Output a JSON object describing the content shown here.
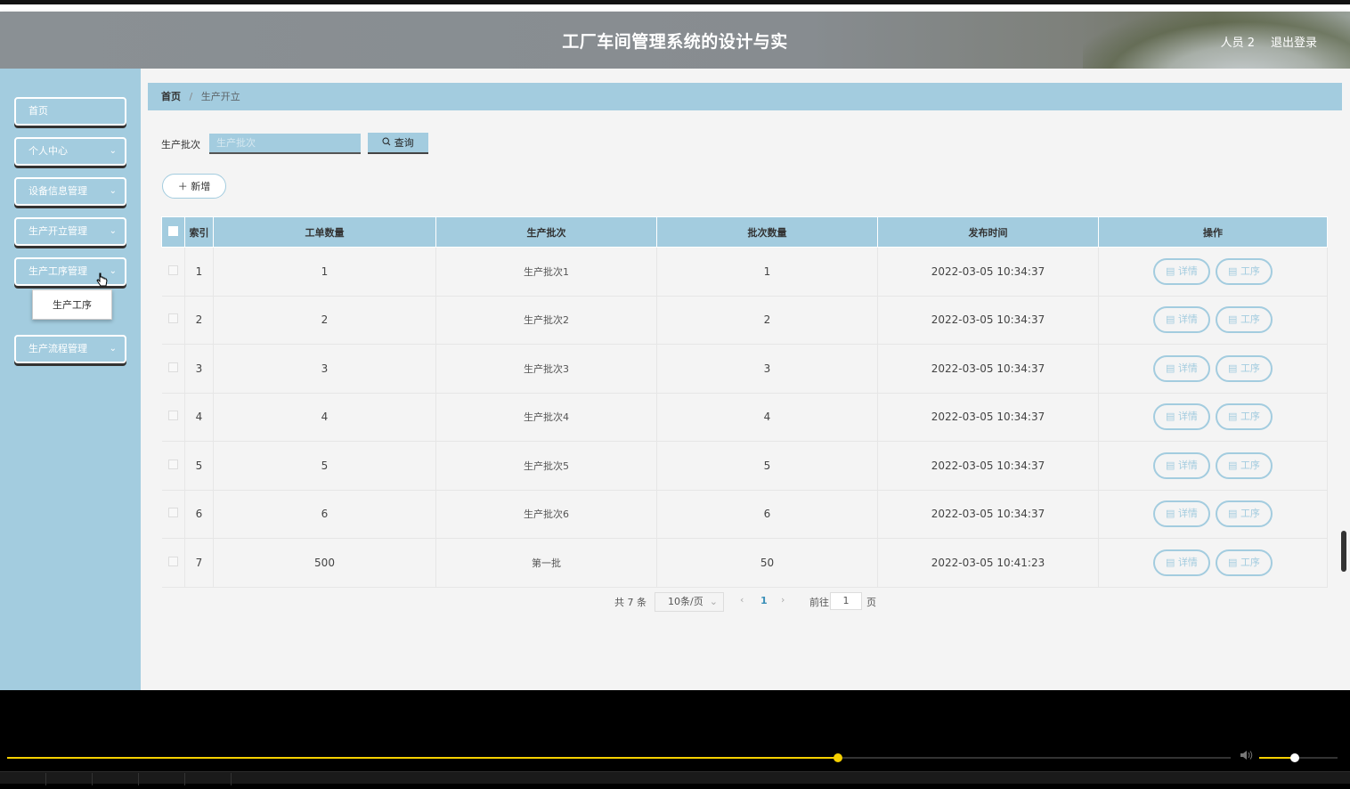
{
  "header": {
    "title": "工厂车间管理系统的设计与实",
    "user": "人员 2",
    "logout": "退出登录"
  },
  "sidebar": {
    "items": [
      {
        "label": "首页",
        "has_chevron": false
      },
      {
        "label": "个人中心",
        "has_chevron": true
      },
      {
        "label": "设备信息管理",
        "has_chevron": true
      },
      {
        "label": "生产开立管理",
        "has_chevron": true
      },
      {
        "label": "生产工序管理",
        "has_chevron": true
      },
      {
        "label": "生产流程管理",
        "has_chevron": true
      }
    ],
    "submenu_item": "生产工序",
    "chevron": "⌄"
  },
  "breadcrumb": {
    "home": "首页",
    "separator": "/",
    "current": "生产开立"
  },
  "search": {
    "label": "生产批次",
    "placeholder": "生产批次",
    "button": "查询",
    "button_icon": "search-icon"
  },
  "add_button": "新增",
  "table": {
    "columns": [
      "索引",
      "工单数量",
      "生产批次",
      "批次数量",
      "发布时间",
      "操作"
    ],
    "rows": [
      {
        "index": "1",
        "orders": "1",
        "batch": "生产批次1",
        "batch_qty": "1",
        "time": "2022-03-05 10:34:37"
      },
      {
        "index": "2",
        "orders": "2",
        "batch": "生产批次2",
        "batch_qty": "2",
        "time": "2022-03-05 10:34:37"
      },
      {
        "index": "3",
        "orders": "3",
        "batch": "生产批次3",
        "batch_qty": "3",
        "time": "2022-03-05 10:34:37"
      },
      {
        "index": "4",
        "orders": "4",
        "batch": "生产批次4",
        "batch_qty": "4",
        "time": "2022-03-05 10:34:37"
      },
      {
        "index": "5",
        "orders": "5",
        "batch": "生产批次5",
        "batch_qty": "5",
        "time": "2022-03-05 10:34:37"
      },
      {
        "index": "6",
        "orders": "6",
        "batch": "生产批次6",
        "batch_qty": "6",
        "time": "2022-03-05 10:34:37"
      },
      {
        "index": "7",
        "orders": "500",
        "batch": "第一批",
        "batch_qty": "50",
        "time": "2022-03-05 10:41:23"
      }
    ],
    "actions": [
      "详情",
      "工序"
    ]
  },
  "pagination": {
    "total": "共 7 条",
    "page_size": "10条/页",
    "current_page": "1",
    "goto_label": "前往",
    "goto_value": "1",
    "page_suffix": "页"
  },
  "player": {
    "progress": 0.679,
    "volume": 0.45
  },
  "colors": {
    "accent": "#a3ccdf",
    "header": "#8a9094",
    "progress": "#f5d000"
  }
}
